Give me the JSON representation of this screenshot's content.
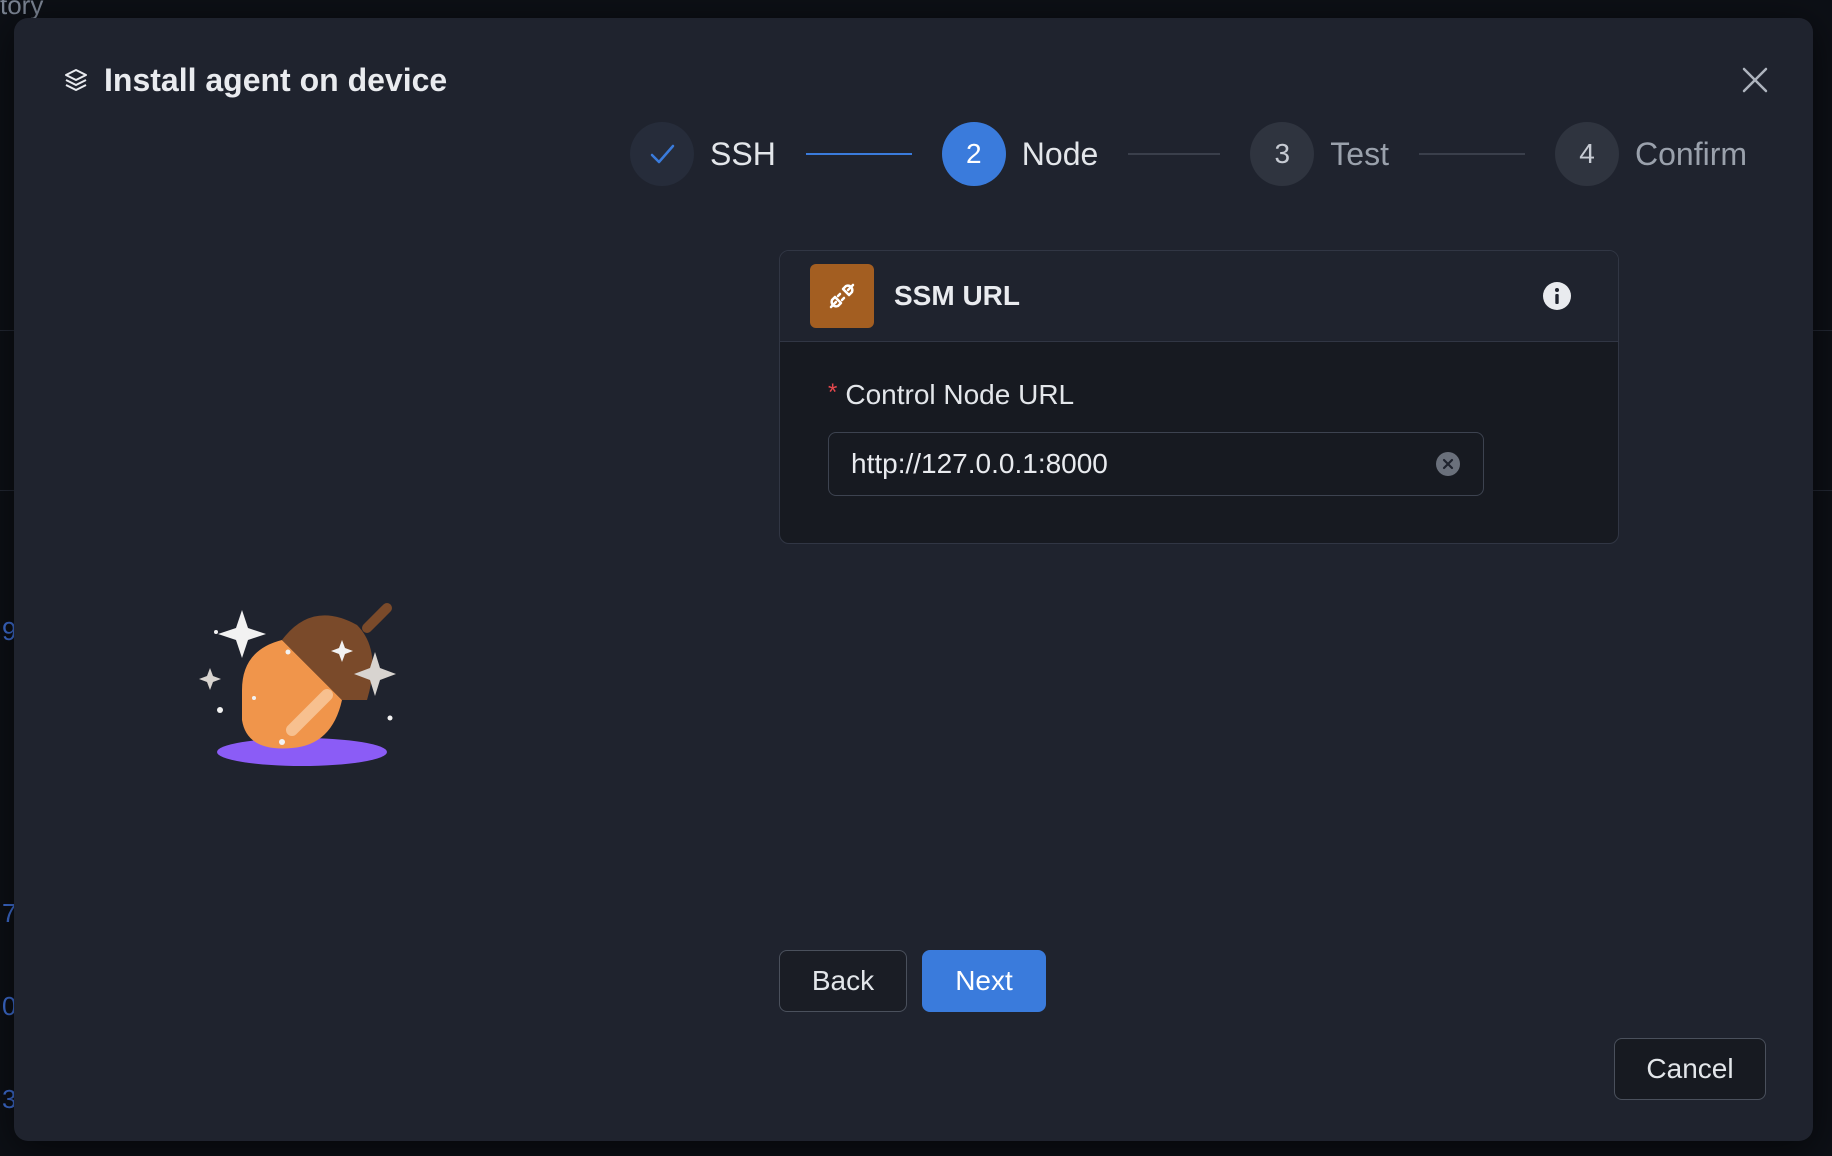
{
  "background": {
    "partial_text": "tory",
    "partial_links": [
      "9",
      "7",
      "0",
      "3"
    ]
  },
  "modal": {
    "title": "Install agent on device",
    "title_icon": "layers-icon",
    "close_icon": "close-icon"
  },
  "stepper": {
    "steps": [
      {
        "number": "",
        "label": "SSH",
        "status": "done"
      },
      {
        "number": "2",
        "label": "Node",
        "status": "active"
      },
      {
        "number": "3",
        "label": "Test",
        "status": "pending"
      },
      {
        "number": "4",
        "label": "Confirm",
        "status": "pending"
      }
    ]
  },
  "card": {
    "title": "SSM URL",
    "icon": "plug-connection-icon",
    "icon_color": "#a35e21",
    "info_icon": "info-icon",
    "field": {
      "required_mark": "*",
      "label": "Control Node URL",
      "value": "http://127.0.0.1:8000"
    }
  },
  "buttons": {
    "back": "Back",
    "next": "Next",
    "cancel": "Cancel"
  },
  "colors": {
    "accent": "#3a7bdc",
    "modal_bg": "#1f232e"
  }
}
